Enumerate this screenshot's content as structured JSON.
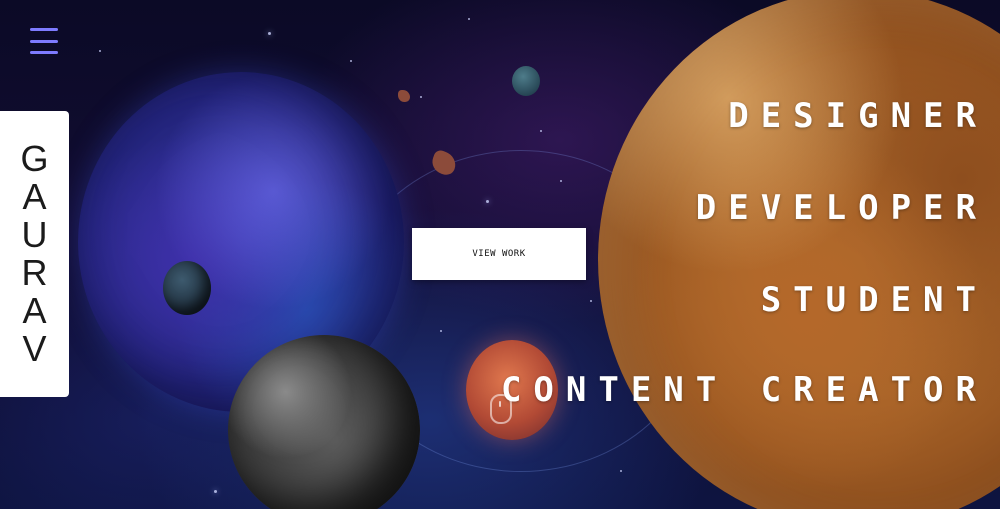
{
  "nav": {
    "menu_icon": "hamburger-menu-icon",
    "menu_color": "#7e7bff"
  },
  "profile": {
    "name": "GAURAV"
  },
  "hero": {
    "cta_label": "VIEW WORK",
    "roles": [
      "DESIGNER",
      "DEVELOPER",
      "STUDENT",
      "CONTENT CREATOR"
    ],
    "scroll_icon": "mouse-scroll-icon"
  },
  "colors": {
    "background": "#0a0b2a",
    "card": "#ffffff",
    "role_text": "#ffffff"
  }
}
